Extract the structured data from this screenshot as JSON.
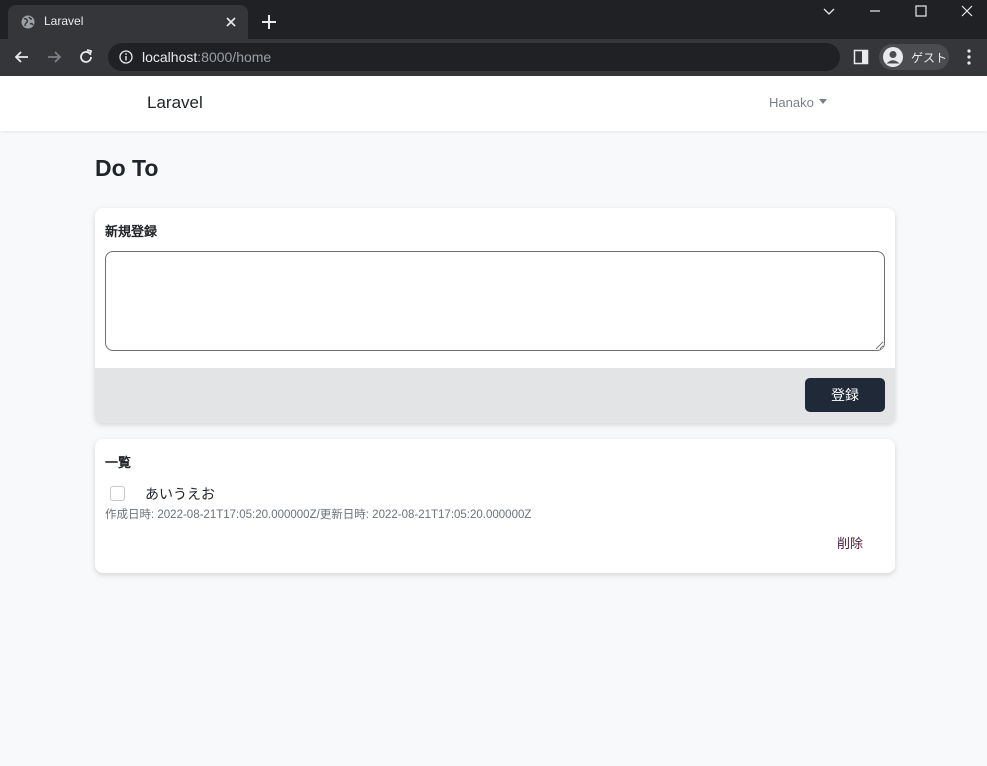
{
  "browser": {
    "tab_title": "Laravel",
    "url_host": "localhost",
    "url_rest": ":8000/home",
    "profile_label": "ゲスト"
  },
  "navbar": {
    "brand": "Laravel",
    "user_name": "Hanako"
  },
  "page": {
    "title": "Do To"
  },
  "new_todo": {
    "header": "新規登録",
    "textarea_value": "",
    "submit_label": "登録"
  },
  "todo_list": {
    "header": "一覧",
    "items": [
      {
        "text": "あいうえお",
        "checked": false,
        "meta": "作成日時: 2022-08-21T17:05:20.000000Z/更新日時: 2022-08-21T17:05:20.000000Z",
        "delete_label": "削除"
      }
    ]
  },
  "colors": {
    "submit_button": "#1f2937",
    "delete_link": "#4a1c3a",
    "page_background": "#f8f9fb"
  }
}
